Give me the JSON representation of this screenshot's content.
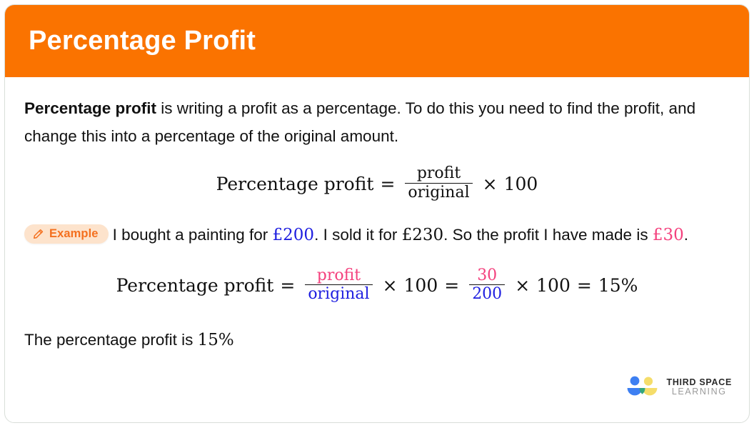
{
  "header": {
    "title": "Percentage Profit",
    "background_color": "#fa7300",
    "text_color": "#ffffff"
  },
  "colors": {
    "accent_orange": "#fa7300",
    "badge_background": "#fde3cc",
    "badge_text": "#f4701f",
    "math_blue": "#1f1fe0",
    "math_pink": "#f4427e",
    "body_text": "#111111"
  },
  "intro": {
    "bold_lead": "Percentage profit",
    "rest": " is writing a profit as a percentage. To do this you need to find the profit, and change this into a percentage of the original amount."
  },
  "formula_definition": {
    "lhs": "Percentage profit",
    "equals": "=",
    "numerator": "profit",
    "denominator": "original",
    "times": "×",
    "multiplier": "100"
  },
  "example": {
    "badge_label": "Example",
    "badge_icon": "pencil-icon",
    "text_1": "I bought a painting for",
    "cost_price": "£200",
    "text_2": ". I sold it for",
    "sale_price": "£230",
    "text_3": ". So the profit I have made is",
    "profit_value": "£30",
    "text_4": "."
  },
  "worked_formula": {
    "lhs": "Percentage profit",
    "equals_1": "=",
    "numerator_1": "profit",
    "denominator_1": "original",
    "times_1": "×",
    "multiplier_1": "100",
    "equals_2": "=",
    "numerator_2": "30",
    "denominator_2": "200",
    "times_2": "×",
    "multiplier_2": "100",
    "equals_3": "=",
    "result": "15%"
  },
  "conclusion": {
    "text": "The percentage profit is",
    "value": "15%"
  },
  "logo": {
    "line1": "THIRD SPACE",
    "line2": "LEARNING",
    "mark_name": "third-space-learning-logo"
  }
}
